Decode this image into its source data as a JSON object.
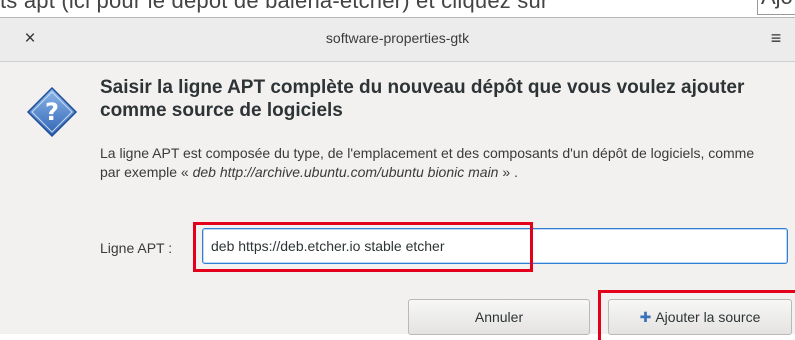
{
  "background_text": {
    "line": "ts apt (ici pour le dépôt de balena-etcher) et cliquez sur",
    "box_text": "Ajo"
  },
  "window": {
    "title": "software-properties-gtk",
    "close_glyph": "×",
    "menu_glyph": "≡"
  },
  "dialog": {
    "icon": "question-icon",
    "heading": "Saisir la ligne APT complète du nouveau dépôt que vous voulez ajouter comme source de logiciels",
    "description_intro": "La ligne APT est composée du type, de l'emplacement et des composants d'un dépôt de logiciels, comme par exemple « ",
    "description_example": "deb http://archive.ubuntu.com/ubuntu bionic main",
    "description_outro": " » .",
    "apt_label": "Ligne APT :",
    "apt_value": "deb https://deb.etcher.io stable etcher",
    "cancel_label": "Annuler",
    "add_icon": "plus-icon",
    "add_label": "Ajouter la source"
  },
  "colors": {
    "highlight": "#e3001b",
    "focus_border": "#2f7fd6",
    "icon_blue": "#3b73b9"
  }
}
